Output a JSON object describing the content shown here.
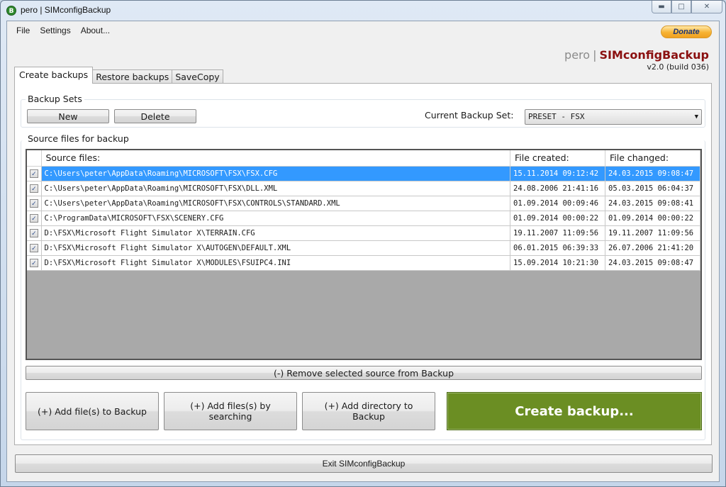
{
  "window": {
    "title": "pero | SIMconfigBackup",
    "controls": {
      "minimize": "minimize-icon",
      "maximize": "maximize-icon",
      "close": "close-icon"
    }
  },
  "menu": {
    "items": [
      "File",
      "Settings",
      "About..."
    ]
  },
  "donate_label": "Donate",
  "brand": {
    "prefix": "pero",
    "separator": "|",
    "name": "SIMconfigBackup",
    "version": "v2.0 (build 036)"
  },
  "tabs": [
    {
      "label": "Create backups",
      "active": true
    },
    {
      "label": "Restore backups",
      "active": false
    },
    {
      "label": "SaveCopy",
      "active": false
    }
  ],
  "backup_sets": {
    "label": "Backup Sets",
    "new_label": "New",
    "delete_label": "Delete",
    "current_label": "Current Backup Set:",
    "current_value": "PRESET - FSX"
  },
  "source_files": {
    "label": "Source files for backup",
    "columns": [
      "Source files:",
      "File created:",
      "File changed:"
    ],
    "rows": [
      {
        "checked": true,
        "selected": true,
        "path": "C:\\Users\\peter\\AppData\\Roaming\\MICROSOFT\\FSX\\FSX.CFG",
        "created": "15.11.2014 09:12:42",
        "changed": "24.03.2015 09:08:47"
      },
      {
        "checked": true,
        "selected": false,
        "path": "C:\\Users\\peter\\AppData\\Roaming\\MICROSOFT\\FSX\\DLL.XML",
        "created": "24.08.2006 21:41:16",
        "changed": "05.03.2015 06:04:37"
      },
      {
        "checked": true,
        "selected": false,
        "path": "C:\\Users\\peter\\AppData\\Roaming\\MICROSOFT\\FSX\\CONTROLS\\STANDARD.XML",
        "created": "01.09.2014 00:09:46",
        "changed": "24.03.2015 09:08:41"
      },
      {
        "checked": true,
        "selected": false,
        "path": "C:\\ProgramData\\MICROSOFT\\FSX\\SCENERY.CFG",
        "created": "01.09.2014 00:00:22",
        "changed": "01.09.2014 00:00:22"
      },
      {
        "checked": true,
        "selected": false,
        "path": "D:\\FSX\\Microsoft Flight Simulator X\\TERRAIN.CFG",
        "created": "19.11.2007 11:09:56",
        "changed": "19.11.2007 11:09:56"
      },
      {
        "checked": true,
        "selected": false,
        "path": "D:\\FSX\\Microsoft Flight Simulator X\\AUTOGEN\\DEFAULT.XML",
        "created": "06.01.2015 06:39:33",
        "changed": "26.07.2006 21:41:20"
      },
      {
        "checked": true,
        "selected": false,
        "path": "D:\\FSX\\Microsoft Flight Simulator X\\MODULES\\FSUIPC4.INI",
        "created": "15.09.2014 10:21:30",
        "changed": "24.03.2015 09:08:47"
      }
    ],
    "remove_label": "(-) Remove selected source from Backup"
  },
  "actions": {
    "add_files": "(+) Add file(s) to Backup",
    "add_search": "(+) Add files(s) by searching",
    "add_directory": "(+) Add directory to Backup",
    "create_backup": "Create backup..."
  },
  "exit_label": "Exit SIMconfigBackup",
  "colors": {
    "selection": "#3399ff",
    "create_button": "#6b8e23",
    "brand_name": "#8b1010",
    "donate": "#f7b333"
  }
}
